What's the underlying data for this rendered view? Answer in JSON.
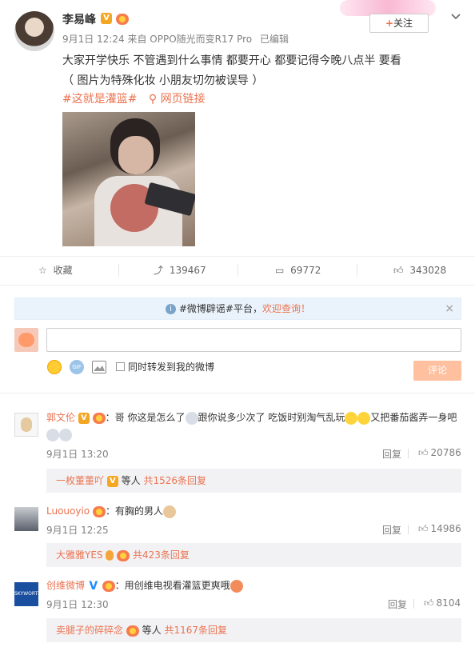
{
  "post": {
    "author": "李易峰",
    "meta": "9月1日 12:24 来自 OPPO随光而变R17 Pro",
    "edited": "已编辑",
    "follow_label": "关注",
    "text_line1": "大家开学快乐 不管遇到什么事情 都要开心 都要记得今晚八点半 要看",
    "text_line2": "（ 图片为特殊化妆 小朋友切勿被误导 ）",
    "topic": "#这就是灌篮#",
    "link": "网页链接",
    "actions": {
      "favorite": "收藏",
      "repost": "139467",
      "comment": "69772",
      "like": "343028"
    }
  },
  "notice": {
    "topic": "#微博辟谣#平台，",
    "link": "欢迎查询！"
  },
  "composer": {
    "checkbox_label": "同时转发到我的微博",
    "submit_label": "评论"
  },
  "comments": [
    {
      "user": "郭文伦",
      "text_a": "：哥 你这是怎么了",
      "text_b": "跟你说多少次了 吃饭时别淘气乱玩",
      "text_c": "又把番茄酱弄一身吧",
      "time": "9月1日 13:20",
      "reply_label": "回复",
      "likes": "20786",
      "sub_user": "一枚董董吖",
      "sub_mid": "等人",
      "sub_count": "共1526条回复"
    },
    {
      "user": "Luouoyio",
      "text_a": "：有胸的男人",
      "time": "9月1日 12:25",
      "reply_label": "回复",
      "likes": "14986",
      "sub_user": "大雅雅YES",
      "sub_count": "共423条回复"
    },
    {
      "user": "创维微博",
      "text_a": "：用创维电视看灌篮更爽哦",
      "time": "9月1日 12:30",
      "reply_label": "回复",
      "likes": "8104",
      "sub_user": "卖腿子的碎碎念",
      "sub_mid": "等人",
      "sub_count": "共1167条回复"
    }
  ],
  "colors": {
    "accent": "#eb7350",
    "button_disabled": "#ffc09f",
    "divider": "#f2f2f5"
  },
  "icons": [
    "avatar",
    "verified-icon",
    "medal-icon",
    "follow-plus-icon",
    "chevron-down-icon",
    "star-icon",
    "repost-icon",
    "comment-icon",
    "like-icon",
    "info-icon",
    "close-icon",
    "smiley-icon",
    "gif-icon",
    "image-icon",
    "link-icon"
  ]
}
